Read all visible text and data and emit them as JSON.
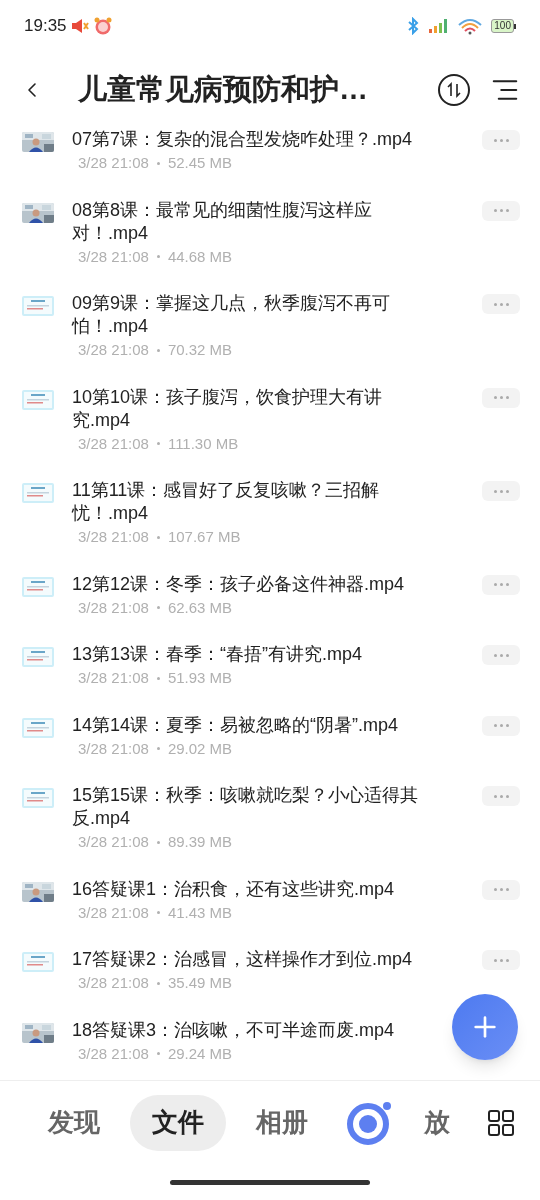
{
  "status_bar": {
    "time": "19:35",
    "battery": "100"
  },
  "header": {
    "title": "儿童常见病预防和护…"
  },
  "files": [
    {
      "name": "07第7课：复杂的混合型发烧咋处理？.mp4",
      "meta": "3/28 21:08",
      "size": "52.45 MB",
      "more_button": true
    },
    {
      "name": "08第8课：最常见的细菌性腹泻这样应对！.mp4",
      "meta": "3/28 21:08",
      "size": "44.68 MB",
      "more_button": true
    },
    {
      "name": "09第9课：掌握这几点，秋季腹泻不再可怕！.mp4",
      "meta": "3/28 21:08",
      "size": "70.32 MB",
      "kind": "slide",
      "more_button": true
    },
    {
      "name": "10第10课：孩子腹泻，饮食护理大有讲究.mp4",
      "meta": "3/28 21:08",
      "size": "111.30 MB",
      "kind": "slide",
      "more_button": true
    },
    {
      "name": "11第11课：感冒好了反复咳嗽？三招解忧！.mp4",
      "meta": "3/28 21:08",
      "size": "107.67 MB",
      "kind": "slide",
      "more_button": true
    },
    {
      "name": "12第12课：冬季：孩子必备这件神器.mp4",
      "meta": "3/28 21:08",
      "size": "62.63 MB",
      "kind": "slide",
      "more_button": true
    },
    {
      "name": "13第13课：春季：“春捂”有讲究.mp4",
      "meta": "3/28 21:08",
      "size": "51.93 MB",
      "kind": "slide",
      "more_button": true
    },
    {
      "name": "14第14课：夏季：易被忽略的“阴暑”.mp4",
      "meta": "3/28 21:08",
      "size": "29.02 MB",
      "kind": "slide",
      "more_button": true
    },
    {
      "name": "15第15课：秋季：咳嗽就吃梨？小心适得其反.mp4",
      "meta": "3/28 21:08",
      "size": "89.39 MB",
      "kind": "slide",
      "more_button": true
    },
    {
      "name": "16答疑课1：治积食，还有这些讲究.mp4",
      "meta": "3/28 21:08",
      "size": "41.43 MB",
      "more_button": true
    },
    {
      "name": "17答疑课2：治感冒，这样操作才到位.mp4",
      "meta": "3/28 21:08",
      "size": "35.49 MB",
      "kind": "slide",
      "more_button": true
    },
    {
      "name": "18答疑课3：治咳嗽，不可半途而废.mp4",
      "meta": "3/28 21:08",
      "size": "29.24 MB",
      "more_button": false
    }
  ],
  "nav": [
    {
      "kind": "tab",
      "label": "发现",
      "selected": false
    },
    {
      "kind": "tab",
      "label": "文件",
      "selected": true
    },
    {
      "kind": "tab",
      "label": "相册",
      "selected": false
    },
    {
      "kind": "logo"
    },
    {
      "kind": "tab",
      "label": "放",
      "selected": false
    },
    {
      "kind": "grid"
    }
  ]
}
